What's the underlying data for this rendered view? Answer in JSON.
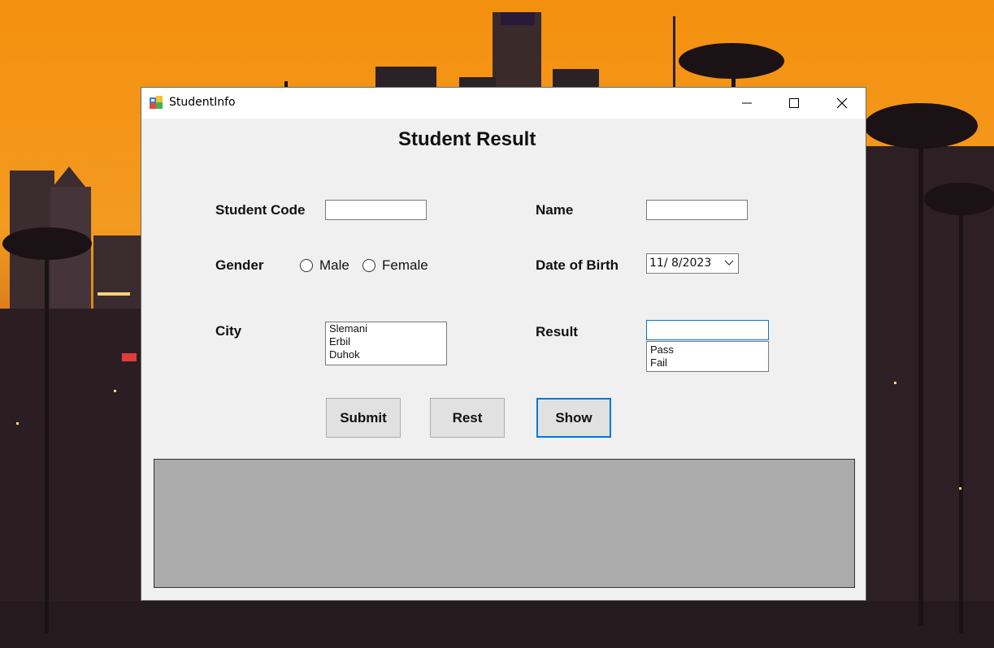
{
  "window": {
    "title": "StudentInfo",
    "icon": "winforms-app-icon"
  },
  "form": {
    "heading": "Student Result",
    "student_code": {
      "label": "Student Code",
      "value": ""
    },
    "name": {
      "label": "Name",
      "value": ""
    },
    "gender": {
      "label": "Gender",
      "options": [
        "Male",
        "Female"
      ],
      "selected": null
    },
    "date_of_birth": {
      "label": "Date of Birth",
      "value": "11/ 8/2023"
    },
    "city": {
      "label": "City",
      "items": [
        "Slemani",
        "Erbil",
        "Duhok"
      ]
    },
    "result": {
      "label": "Result",
      "value": "",
      "items": [
        "Pass",
        "Fail"
      ]
    }
  },
  "buttons": {
    "submit": "Submit",
    "reset": "Rest",
    "show": "Show"
  },
  "colors": {
    "accent_focus": "#0078d7",
    "grid_background": "#ababab",
    "form_background": "#f0f0f0"
  }
}
